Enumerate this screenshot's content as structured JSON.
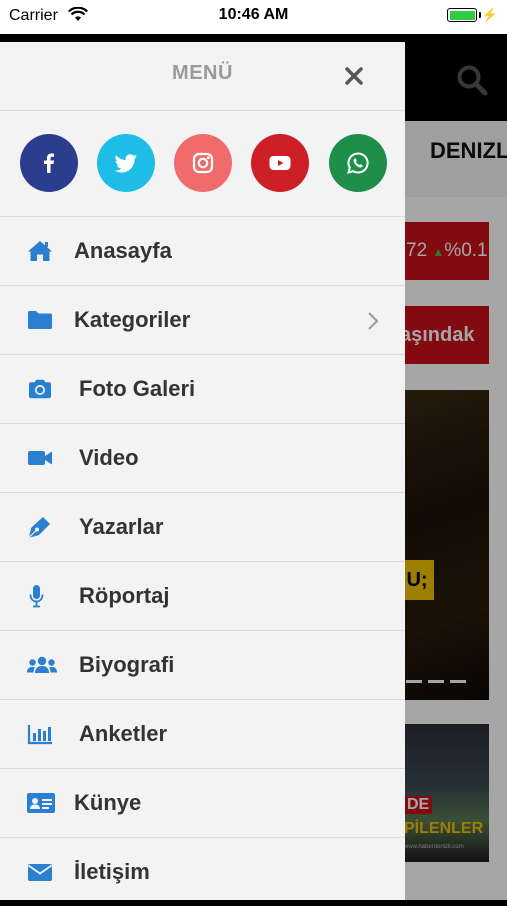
{
  "status_bar": {
    "carrier": "Carrier",
    "time": "10:46 AM",
    "battery_level": 1.0
  },
  "background": {
    "tab_label": "DENIZL",
    "ticker_value": "72",
    "ticker_change": "%0.1",
    "breaking_text": "aşındak",
    "photo_tag": "U;",
    "photo2_line1": "DE",
    "photo2_line2": "PİLENLER",
    "photo2_line3": "www.haberdenizli.com"
  },
  "drawer": {
    "title": "MENÜ",
    "social": [
      {
        "name": "facebook",
        "color": "#2d3d8e",
        "icon": "facebook-icon"
      },
      {
        "name": "twitter",
        "color": "#1dbde8",
        "icon": "twitter-icon"
      },
      {
        "name": "instagram",
        "color": "#f06b6b",
        "icon": "instagram-icon"
      },
      {
        "name": "youtube",
        "color": "#cc1f26",
        "icon": "youtube-icon"
      },
      {
        "name": "whatsapp",
        "color": "#1e8e4a",
        "icon": "whatsapp-icon"
      }
    ],
    "items": [
      {
        "label": "Anasayfa",
        "icon": "home-icon"
      },
      {
        "label": "Kategoriler",
        "icon": "folder-icon",
        "has_submenu": true
      },
      {
        "label": "Foto Galeri",
        "icon": "camera-icon"
      },
      {
        "label": "Video",
        "icon": "video-icon"
      },
      {
        "label": "Yazarlar",
        "icon": "pen-icon"
      },
      {
        "label": "Röportaj",
        "icon": "microphone-icon"
      },
      {
        "label": "Biyografi",
        "icon": "users-icon"
      },
      {
        "label": "Anketler",
        "icon": "bar-chart-icon"
      },
      {
        "label": "Künye",
        "icon": "id-card-icon"
      },
      {
        "label": "İletişim",
        "icon": "envelope-icon"
      }
    ]
  },
  "colors": {
    "accent": "#2a7fd0",
    "ticker_bg": "#c8101a"
  }
}
